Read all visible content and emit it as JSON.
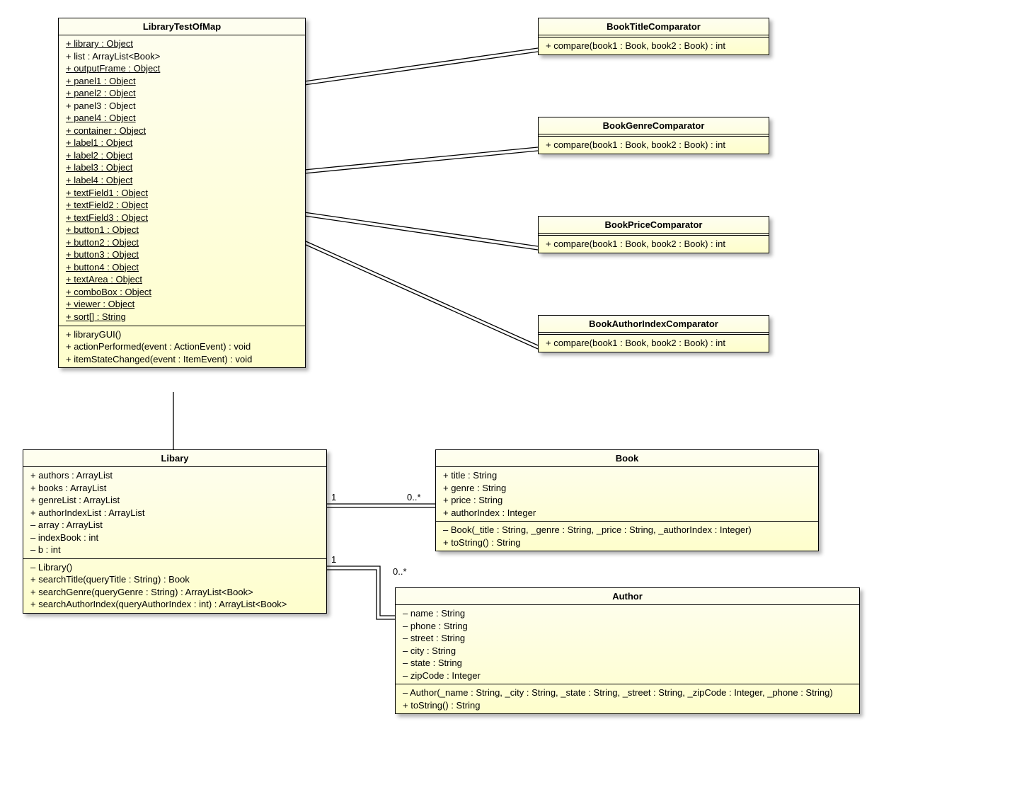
{
  "classes": {
    "libraryTestOfMap": {
      "name": "LibraryTestOfMap",
      "attrs": [
        {
          "t": "+ library : Object",
          "u": true
        },
        {
          "t": "+ list : ArrayList<Book>",
          "u": false
        },
        {
          "t": "+ outputFrame : Object",
          "u": true
        },
        {
          "t": "+ panel1 : Object",
          "u": true
        },
        {
          "t": "+ panel2 : Object",
          "u": true
        },
        {
          "t": "+ panel3 : Object",
          "u": false
        },
        {
          "t": "+ panel4 : Object",
          "u": true
        },
        {
          "t": "+ container : Object",
          "u": true
        },
        {
          "t": "+ label1 : Object",
          "u": true
        },
        {
          "t": "+ label2 : Object",
          "u": true
        },
        {
          "t": "+ label3 : Object",
          "u": true
        },
        {
          "t": "+ label4 : Object",
          "u": true
        },
        {
          "t": "+ textField1 : Object",
          "u": true
        },
        {
          "t": "+ textField2 : Object",
          "u": true
        },
        {
          "t": "+ textField3 : Object",
          "u": true
        },
        {
          "t": "+ button1 : Object",
          "u": true
        },
        {
          "t": "+ button2 : Object",
          "u": true
        },
        {
          "t": "+ button3 : Object",
          "u": true
        },
        {
          "t": "+ button4 : Object",
          "u": true
        },
        {
          "t": "+ textArea : Object",
          "u": true
        },
        {
          "t": "+ comboBox : Object",
          "u": true
        },
        {
          "t": "+ viewer : Object",
          "u": true
        },
        {
          "t": "+ sort[] : String",
          "u": true
        }
      ],
      "ops": [
        {
          "t": "+ libraryGUI()"
        },
        {
          "t": "+ actionPerformed(event : ActionEvent) : void"
        },
        {
          "t": "+ itemStateChanged(event : ItemEvent) : void"
        }
      ]
    },
    "bookTitleComparator": {
      "name": "BookTitleComparator",
      "ops": [
        {
          "t": "+ compare(book1 : Book, book2 : Book) : int"
        }
      ]
    },
    "bookGenreComparator": {
      "name": "BookGenreComparator",
      "ops": [
        {
          "t": "+ compare(book1 : Book, book2 : Book) : int"
        }
      ]
    },
    "bookPriceComparator": {
      "name": "BookPriceComparator",
      "ops": [
        {
          "t": "+ compare(book1 : Book, book2 : Book) : int"
        }
      ]
    },
    "bookAuthorIndexComparator": {
      "name": "BookAuthorIndexComparator",
      "ops": [
        {
          "t": "+ compare(book1 : Book, book2 : Book) : int"
        }
      ]
    },
    "library": {
      "name": "Libary",
      "attrs": [
        {
          "t": "+ authors : ArrayList"
        },
        {
          "t": "+ books : ArrayList"
        },
        {
          "t": "+ genreList : ArrayList"
        },
        {
          "t": "+ authorIndexList : ArrayList"
        },
        {
          "t": "– array : ArrayList"
        },
        {
          "t": "– indexBook : int"
        },
        {
          "t": "– b : int"
        }
      ],
      "ops": [
        {
          "t": "– Library()"
        },
        {
          "t": "+ searchTitle(queryTitle : String) : Book"
        },
        {
          "t": "+ searchGenre(queryGenre : String) : ArrayList<Book>"
        },
        {
          "t": "+ searchAuthorIndex(queryAuthorIndex : int) : ArrayList<Book>"
        }
      ]
    },
    "book": {
      "name": "Book",
      "attrs": [
        {
          "t": "+ title : String"
        },
        {
          "t": "+ genre : String"
        },
        {
          "t": "+ price : String"
        },
        {
          "t": "+ authorIndex : Integer"
        }
      ],
      "ops": [
        {
          "t": "– Book(_title : String, _genre : String, _price : String, _authorIndex : Integer)"
        },
        {
          "t": "+ toString() : String"
        }
      ]
    },
    "author": {
      "name": "Author",
      "attrs": [
        {
          "t": "– name : String"
        },
        {
          "t": "– phone : String"
        },
        {
          "t": "– street : String"
        },
        {
          "t": "– city : String"
        },
        {
          "t": "– state : String"
        },
        {
          "t": "– zipCode : Integer"
        }
      ],
      "ops": [
        {
          "t": "– Author(_name : String, _city : String, _state : String, _street : String, _zipCode : Integer, _phone : String)"
        },
        {
          "t": "+ toString() : String"
        }
      ]
    }
  },
  "multiplicity": {
    "one": "1",
    "many": "0..*"
  }
}
